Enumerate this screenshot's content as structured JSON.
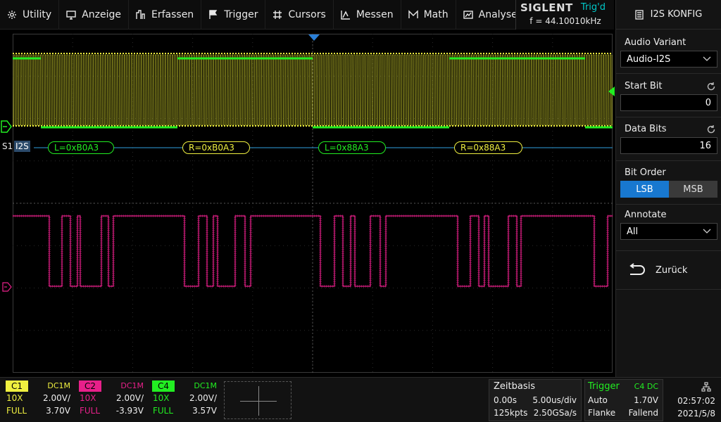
{
  "menu": {
    "items": [
      {
        "label": "Utility",
        "icon": "gear-icon"
      },
      {
        "label": "Anzeige",
        "icon": "monitor-icon"
      },
      {
        "label": "Erfassen",
        "icon": "acquire-icon"
      },
      {
        "label": "Trigger",
        "icon": "flag-icon"
      },
      {
        "label": "Cursors",
        "icon": "crosshair-icon"
      },
      {
        "label": "Messen",
        "icon": "measure-icon"
      },
      {
        "label": "Math",
        "icon": "math-icon"
      },
      {
        "label": "Analyse",
        "icon": "analyse-icon"
      }
    ]
  },
  "brand": {
    "logo": "SIGLENT",
    "trigger_status": "Trig'd",
    "frequency": "f = 44.10010kHz"
  },
  "panel": {
    "title": "I2S KONFIG",
    "audio_variant": {
      "label": "Audio Variant",
      "value": "Audio-I2S"
    },
    "start_bit": {
      "label": "Start Bit",
      "value": "0"
    },
    "data_bits": {
      "label": "Data Bits",
      "value": "16"
    },
    "bit_order": {
      "label": "Bit Order",
      "options": [
        "LSB",
        "MSB"
      ],
      "selected": "LSB"
    },
    "annotate": {
      "label": "Annotate",
      "value": "All"
    },
    "back_label": "Zurück"
  },
  "decode": {
    "bus_label": "S1",
    "protocol": "I2S",
    "frames": [
      {
        "text": "L=0xB0A3",
        "channel": "L"
      },
      {
        "text": "R=0xB0A3",
        "channel": "R"
      },
      {
        "text": "L=0x88A3",
        "channel": "L"
      },
      {
        "text": "R=0x88A3",
        "channel": "R"
      }
    ]
  },
  "channels": [
    {
      "name": "C1",
      "coupling": "DC1M",
      "probe": "10X",
      "scale": "2.00V/",
      "bandwidth": "FULL",
      "offset": "3.70V",
      "color": "#f0f040"
    },
    {
      "name": "C2",
      "coupling": "DC1M",
      "probe": "10X",
      "scale": "2.00V/",
      "bandwidth": "FULL",
      "offset": "-3.93V",
      "color": "#e8208a"
    },
    {
      "name": "C4",
      "coupling": "DC1M",
      "probe": "10X",
      "scale": "2.00V/",
      "bandwidth": "FULL",
      "offset": "3.57V",
      "color": "#22ee22"
    }
  ],
  "timebase": {
    "title": "Zeitbasis",
    "delay": "0.00s",
    "scale": "5.00us/div",
    "memory": "125kpts",
    "sample_rate": "2.50GSa/s"
  },
  "trigger": {
    "title": "Trigger",
    "source": "C4 DC",
    "mode": "Auto",
    "level": "1.70V",
    "type": "Flanke",
    "slope": "Fallend"
  },
  "clock": {
    "time": "02:57:02",
    "date": "2021/5/8"
  }
}
